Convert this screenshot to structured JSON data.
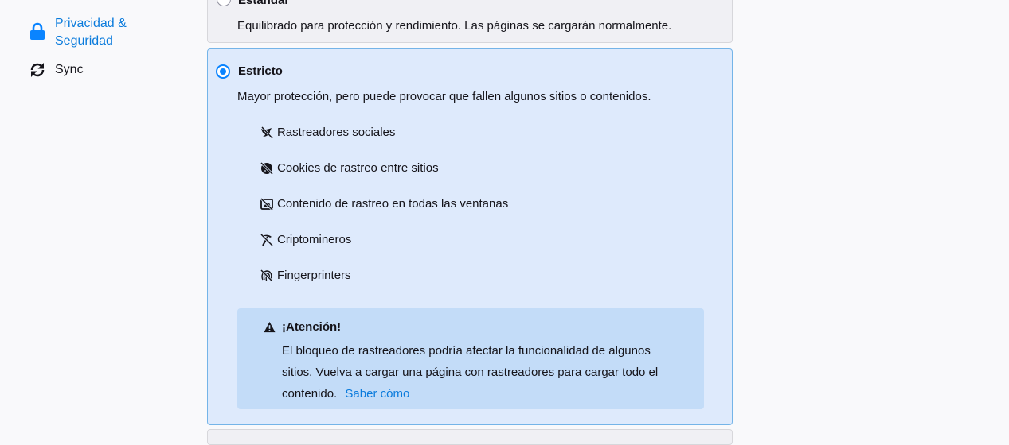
{
  "sidebar": {
    "items": [
      {
        "label": "Privacidad & Seguridad",
        "label_lines": [
          "Privacidad &",
          "Seguridad"
        ],
        "icon": "lock-icon",
        "active": true
      },
      {
        "label": "Sync",
        "icon": "sync-icon",
        "active": false
      }
    ]
  },
  "standard": {
    "title": "Estándar",
    "description": "Equilibrado para protección y rendimiento. Las páginas se cargarán normalmente.",
    "selected": false
  },
  "strict": {
    "title": "Estricto",
    "description": "Mayor protección, pero puede provocar que fallen algunos sitios o contenidos.",
    "selected": true,
    "trackers": [
      {
        "label": "Rastreadores sociales",
        "icon": "social-tracker-icon"
      },
      {
        "label": "Cookies de rastreo entre sitios",
        "icon": "cookie-icon"
      },
      {
        "label": "Contenido de rastreo en todas las ventanas",
        "icon": "tracking-content-icon"
      },
      {
        "label": "Criptomineros",
        "icon": "cryptominer-icon"
      },
      {
        "label": "Fingerprinters",
        "icon": "fingerprint-icon"
      }
    ],
    "warning": {
      "title": "¡Atención!",
      "lines": [
        "El bloqueo de rastreadores podría afectar la funcionalidad de algunos",
        "sitios. Vuelva a cargar una página con rastreadores para cargar todo el",
        "contenido."
      ],
      "link": "Saber cómo"
    }
  },
  "colors": {
    "accent": "#0a84ff",
    "link": "#0a7bdc",
    "strict_background": "#deeafc",
    "strict_border": "#74b4e8",
    "warning_background": "#c3dcf8"
  }
}
